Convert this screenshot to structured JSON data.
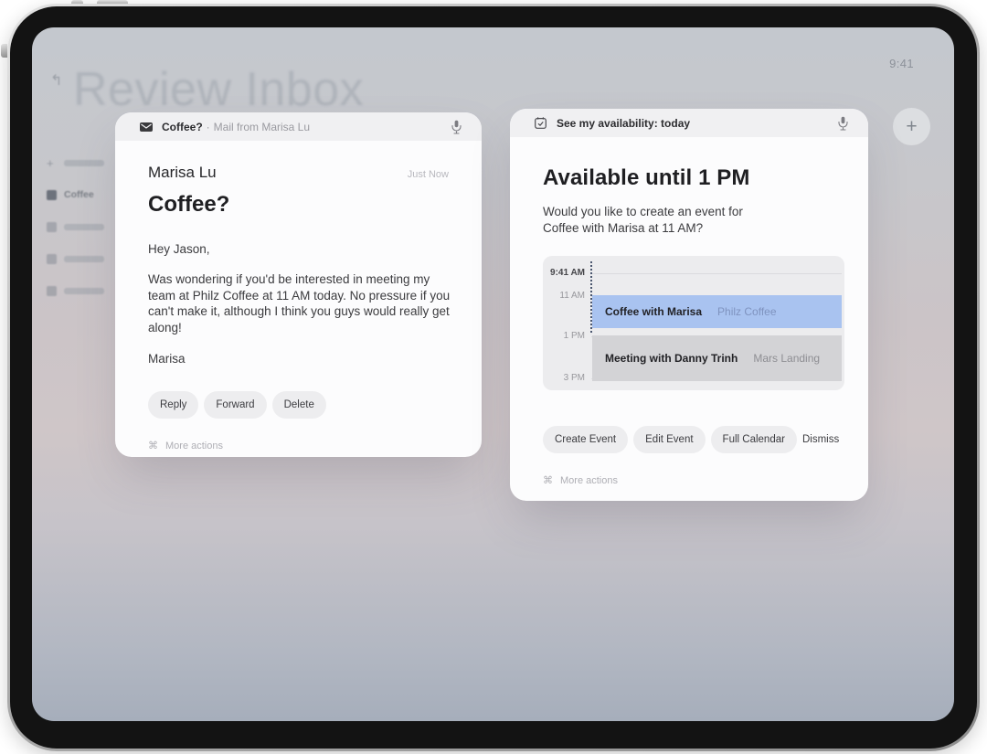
{
  "status_bar": {
    "time": "9:41"
  },
  "background": {
    "title": "Review Inbox",
    "return_icon": "↰",
    "sidebar_coffee_label": "Coffee"
  },
  "add_button_label": "+",
  "mail_card": {
    "header": {
      "title": "Coffee?",
      "separator": "·",
      "subtitle": "Mail from Marisa Lu"
    },
    "sender": "Marisa Lu",
    "timestamp": "Just Now",
    "subject": "Coffee?",
    "greeting": "Hey Jason,",
    "body": "Was wondering if you'd be interested in meeting my team at Philz Coffee at 11 AM today. No pressure if you can't make it, although I think you guys would really get along!",
    "signature": "Marisa",
    "buttons": [
      "Reply",
      "Forward",
      "Delete"
    ],
    "more_actions": {
      "icon": "⌘",
      "label": "More actions"
    }
  },
  "calendar_card": {
    "header": {
      "title": "See my availability: today"
    },
    "title": "Available until 1 PM",
    "body_line1": "Would you like to create an event for",
    "body_line2": "Coffee with Marisa at 11 AM?",
    "schedule": {
      "time_labels": [
        "9:41 AM",
        "11 AM",
        "1 PM",
        "3 PM"
      ],
      "events": [
        {
          "title": "Coffee with Marisa",
          "location": "Philz Coffee",
          "color": "#a9c3f0"
        },
        {
          "title": "Meeting with Danny Trinh",
          "location": "Mars Landing",
          "color": "#d3d3d6"
        }
      ],
      "accent_blue": "#a9c3f0",
      "now_line_color": "#4a566e"
    },
    "buttons": [
      "Create Event",
      "Edit Event",
      "Full Calendar"
    ],
    "dismiss_label": "Dismiss",
    "more_actions": {
      "icon": "⌘",
      "label": "More actions"
    }
  }
}
